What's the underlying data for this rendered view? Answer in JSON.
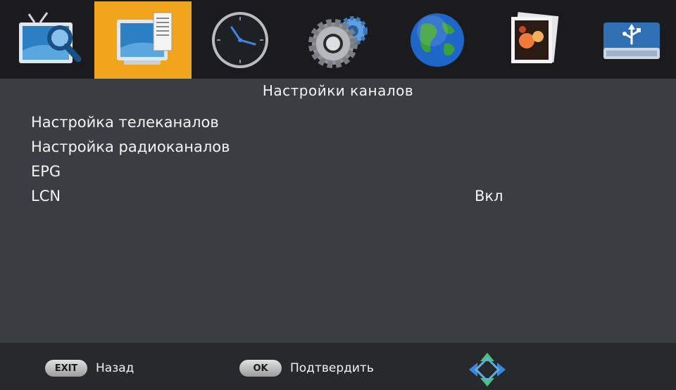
{
  "tabs": [
    {
      "icon": "tv-search-icon",
      "active": false
    },
    {
      "icon": "channel-settings-icon",
      "active": true
    },
    {
      "icon": "clock-icon",
      "active": false
    },
    {
      "icon": "gears-icon",
      "active": false
    },
    {
      "icon": "globe-icon",
      "active": false
    },
    {
      "icon": "photos-icon",
      "active": false
    },
    {
      "icon": "usb-drive-icon",
      "active": false
    }
  ],
  "page": {
    "title": "Настройки каналов"
  },
  "menu": {
    "items": [
      {
        "label": "Настройка телеканалов",
        "value": ""
      },
      {
        "label": "Настройка радиоканалов",
        "value": ""
      },
      {
        "label": "EPG",
        "value": ""
      },
      {
        "label": "LCN",
        "value": "Вкл"
      }
    ]
  },
  "hints": {
    "exit_key": "EXIT",
    "exit_label": "Назад",
    "ok_key": "OK",
    "ok_label": "Подтвердить"
  },
  "colors": {
    "background": "#3a3e43",
    "topbar": "#1b1b1d",
    "active_tab": "#f0a51c",
    "bottombar": "#27292c"
  }
}
